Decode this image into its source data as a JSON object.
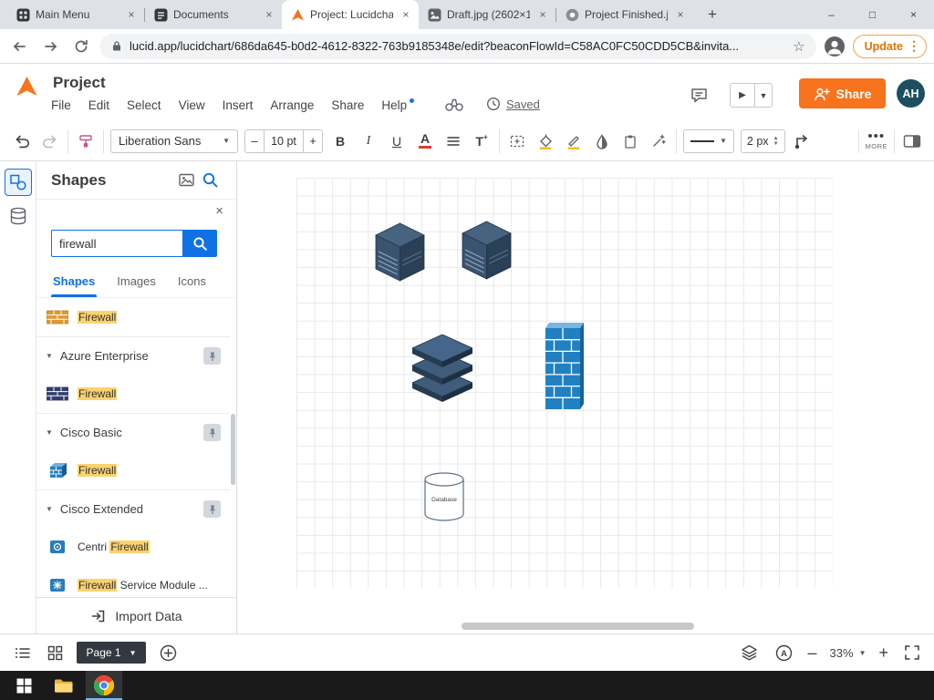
{
  "browser": {
    "tabs": [
      {
        "title": "Main Menu"
      },
      {
        "title": "Documents"
      },
      {
        "title": "Project: Lucidchar"
      },
      {
        "title": "Draft.jpg (2602×1"
      },
      {
        "title": "Project Finished.j"
      }
    ],
    "url": "lucid.app/lucidchart/686da645-b0d2-4612-8322-763b9185348e/edit?beaconFlowId=C58AC0FC50CDD5CB&invita...",
    "update_label": "Update"
  },
  "app": {
    "title": "Project",
    "menus": [
      "File",
      "Edit",
      "Select",
      "View",
      "Insert",
      "Arrange",
      "Share",
      "Help"
    ],
    "saved_label": "Saved",
    "share_label": "Share",
    "avatar_initials": "AH"
  },
  "toolbar": {
    "font_family_value": "Liberation Sans",
    "font_size_value": "10 pt",
    "bold_label": "B",
    "italic_label": "I",
    "underline_label": "U",
    "text_color_label": "A",
    "text_style_label": "T",
    "line_width_value": "2 px",
    "more_label": "MORE"
  },
  "shapes_panel": {
    "title": "Shapes",
    "search_value": "firewall",
    "tabs": [
      "Shapes",
      "Images",
      "Icons"
    ],
    "rows": [
      {
        "pre": "",
        "hl": "Firewall",
        "post": ""
      },
      {
        "label": "Azure Enterprise"
      },
      {
        "pre": "",
        "hl": "Firewall",
        "post": ""
      },
      {
        "label": "Cisco Basic"
      },
      {
        "pre": "",
        "hl": "Firewall",
        "post": ""
      },
      {
        "label": "Cisco Extended"
      },
      {
        "pre": "Centri ",
        "hl": "Firewall",
        "post": ""
      },
      {
        "pre": "",
        "hl": "Firewall",
        "post": " Service Module ..."
      }
    ],
    "import_label": "Import Data"
  },
  "canvas": {
    "database_label": "Database"
  },
  "statusbar": {
    "page_label": "Page 1",
    "zoom_value": "33%"
  },
  "theme": {
    "accent": "#1071e5",
    "orange": "#f7731d",
    "highlight": "#fcd26e",
    "avatar": "#1d4f5f",
    "update": "#e37400"
  }
}
